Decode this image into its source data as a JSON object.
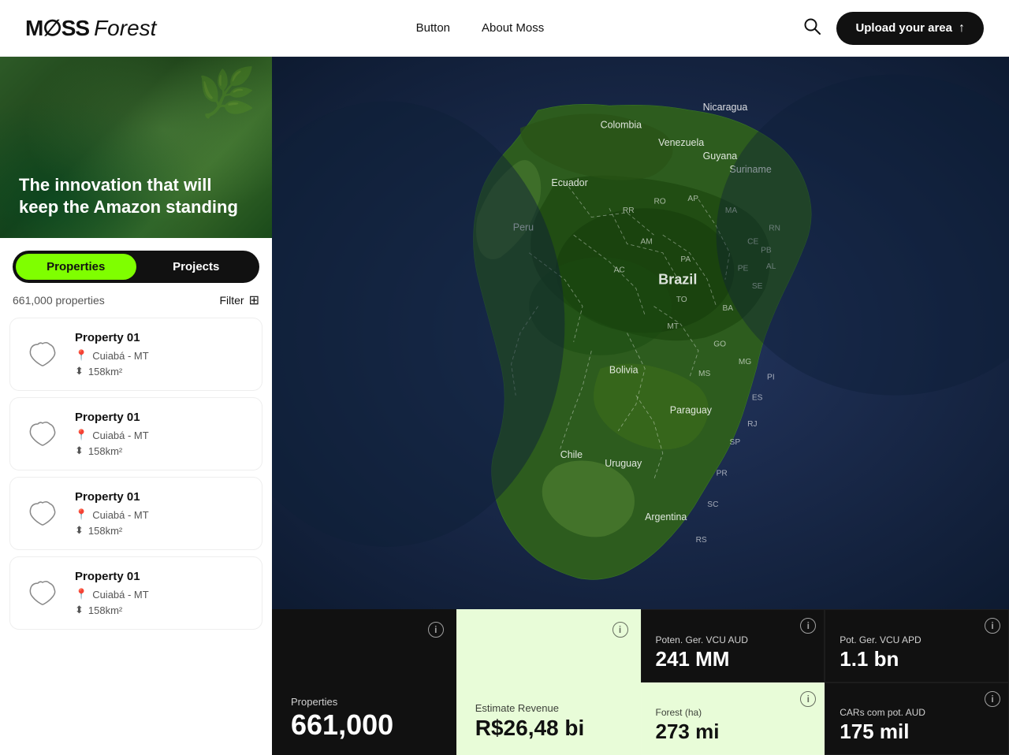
{
  "nav": {
    "logo_moss": "M∅SS",
    "logo_forest": "Forest",
    "links": [
      {
        "id": "button",
        "label": "Button"
      },
      {
        "id": "about",
        "label": "About Moss"
      }
    ],
    "upload_label": "Upload your area"
  },
  "hero": {
    "text": "The innovation that will keep the Amazon standing"
  },
  "tabs": [
    {
      "id": "properties",
      "label": "Properties",
      "active": true
    },
    {
      "id": "projects",
      "label": "Projects",
      "active": false
    }
  ],
  "filter": {
    "count_label": "661,000 properties",
    "button_label": "Filter"
  },
  "properties": [
    {
      "name": "Property 01",
      "location": "Cuiabá - MT",
      "area": "158km²"
    },
    {
      "name": "Property 01",
      "location": "Cuiabá - MT",
      "area": "158km²"
    },
    {
      "name": "Property 01",
      "location": "Cuiabá - MT",
      "area": "158km²"
    },
    {
      "name": "Property 01",
      "location": "Cuiabá - MT",
      "area": "158km²"
    }
  ],
  "stats": [
    {
      "id": "properties-count",
      "theme": "dark",
      "label": "Properties",
      "value": "661,000",
      "sub": ""
    },
    {
      "id": "estimate-revenue",
      "theme": "light-green",
      "label": "Estimate Revenue",
      "value": "R$26,48 bi",
      "sub": ""
    },
    {
      "id": "poten-ger-vcu-aud",
      "theme": "dark-green",
      "label": "Poten. Ger. VCU AUD",
      "value": "241 MM",
      "sub": ""
    },
    {
      "id": "pot-ger-vcu-apd",
      "theme": "dark",
      "label": "Pot. Ger. VCU APD",
      "value": "1.1 bn",
      "sub": ""
    },
    {
      "id": "forest-ha",
      "theme": "light-green2",
      "label": "Forest (ha)",
      "value": "273 mi",
      "sub": ""
    },
    {
      "id": "cars-com-pot-aud",
      "theme": "dark",
      "label": "CARs com pot. AUD",
      "value": "175 mil",
      "sub": ""
    }
  ],
  "colors": {
    "accent_green": "#7fff00",
    "dark": "#111111",
    "light_green_bg": "#e8fcd8"
  }
}
